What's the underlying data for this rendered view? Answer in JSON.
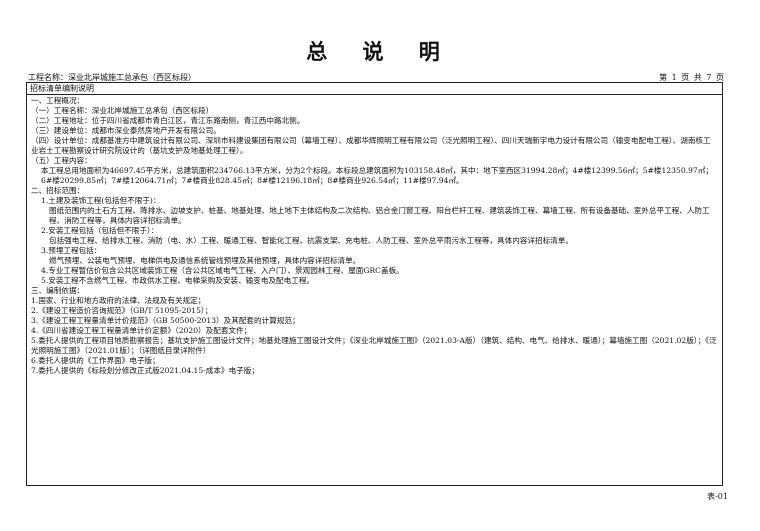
{
  "title": "总 说 明",
  "project_label": "工程名称：深业北岸城施工总承包（西区标段）",
  "page_indicator": "第 1 页 共 7 页",
  "section_header": "招标清单编制说明",
  "lines": [
    {
      "text": "一、工程概况：",
      "indent": 0
    },
    {
      "text": "（一）工程名称：深业北岸城施工总承包（西区标段）",
      "indent": 0
    },
    {
      "text": "（二）工程地址：位于四川省成都市青白江区，青江东路南侧，青江西中路北侧。",
      "indent": 0
    },
    {
      "text": "（三）建设单位：成都市深业泰然房地产开发有限公司。",
      "indent": 0
    },
    {
      "text": "（四）设计单位：成都基准方中建筑设计有限公司、深圳市科建设集团有限公司（幕墙工程）、成都华辉照明工程有限公司（泛光照明工程）、四川天瑞新宇电力设计有限公司（输变电配电工程）、湖南核工业岩土工程勘察设计研究院设计的（基坑支护及地基处理工程）。",
      "indent": 0,
      "wrap": true
    },
    {
      "text": "（五）工程内容：",
      "indent": 0
    },
    {
      "text": "本工程总用地面积为46697.45平方米，总建筑面积234766.13平方米，分为2个标段。本标段总建筑面积为103158.48㎡，其中：地下室西区31994.28㎡；4#楼12399.56㎡；5#楼12350.97㎡；6#楼20299.85㎡；7#楼12064.71㎡；7#楼商业828.45㎡；8#楼12196.18㎡；8#楼商业926.54㎡；11#楼97.94㎡。",
      "indent": 1,
      "wrap": true
    },
    {
      "text": "二、招标范围：",
      "indent": 0
    },
    {
      "text": "1.土建及装饰工程(包括但不限于)：",
      "indent": 1
    },
    {
      "text": "图纸范围内的土石方工程、降排水、边坡支护、桩基、地基处理、地上地下主体结构及二次结构、铝合金门窗工程、阳台栏杆工程、建筑装饰工程、幕墙工程、所有设备基础、室外总平工程、人防工程、消防工程等，具体内容详招标清单。",
      "indent": 2,
      "wrap": true
    },
    {
      "text": "2.安装工程包括（包括但不限于）：",
      "indent": 1
    },
    {
      "text": "包括强电工程、给排水工程、消防（电、水）工程、暖通工程、智能化工程、抗震支架、充电桩、人防工程、室外总平雨污水工程等，具体内容详招标清单。",
      "indent": 2
    },
    {
      "text": "3.预埋工程包括：",
      "indent": 1
    },
    {
      "text": "燃气预埋、公装电气预埋、电梯供电及通信系统管线预埋及其他预埋，具体内容详招标清单。",
      "indent": 2
    },
    {
      "text": "4.专业工程暂估价包含公共区域装饰工程（含公共区域电气工程、入户门）、景观园林工程、屋面GRC盖板。",
      "indent": 1
    },
    {
      "text": "5.安装工程不含燃气工程、市政供水工程、电梯采购及安装、输变电及配电工程。",
      "indent": 1
    },
    {
      "text": "三、编制依据：",
      "indent": 0
    },
    {
      "text": "1.国家、行业和地方政府的法律、法规及有关规定；",
      "indent": 0
    },
    {
      "text": "2.《建设工程造价咨询规范》（GB/T 51095-2015）；",
      "indent": 0
    },
    {
      "text": "3.《建设工程工程量清单计价规范》（GB 50500-2013）及其配套的计算规范；",
      "indent": 0
    },
    {
      "text": "4.《四川省建设工程工程量清单计价定额》（2020）及配套文件；",
      "indent": 0
    },
    {
      "text": "5.委托人提供的工程项目地质勘察报告；基坑支护施工图设计文件；地基处理施工图设计文件；《深业北岸城施工图》（2021.03-A版）（建筑、结构、电气、给排水、暖通）；幕墙施工图（2021.02版）；《泛光照明施工图》（2021.01版）；（详图纸目录详附件）",
      "indent": 0,
      "wrap": true
    },
    {
      "text": "6.委托人提供的《工作界面》电子版；",
      "indent": 0
    },
    {
      "text": "7.委托人提供的《标段划分修改正式版2021.04.15-成本》电子版；",
      "indent": 0
    }
  ],
  "footer": "表-01"
}
